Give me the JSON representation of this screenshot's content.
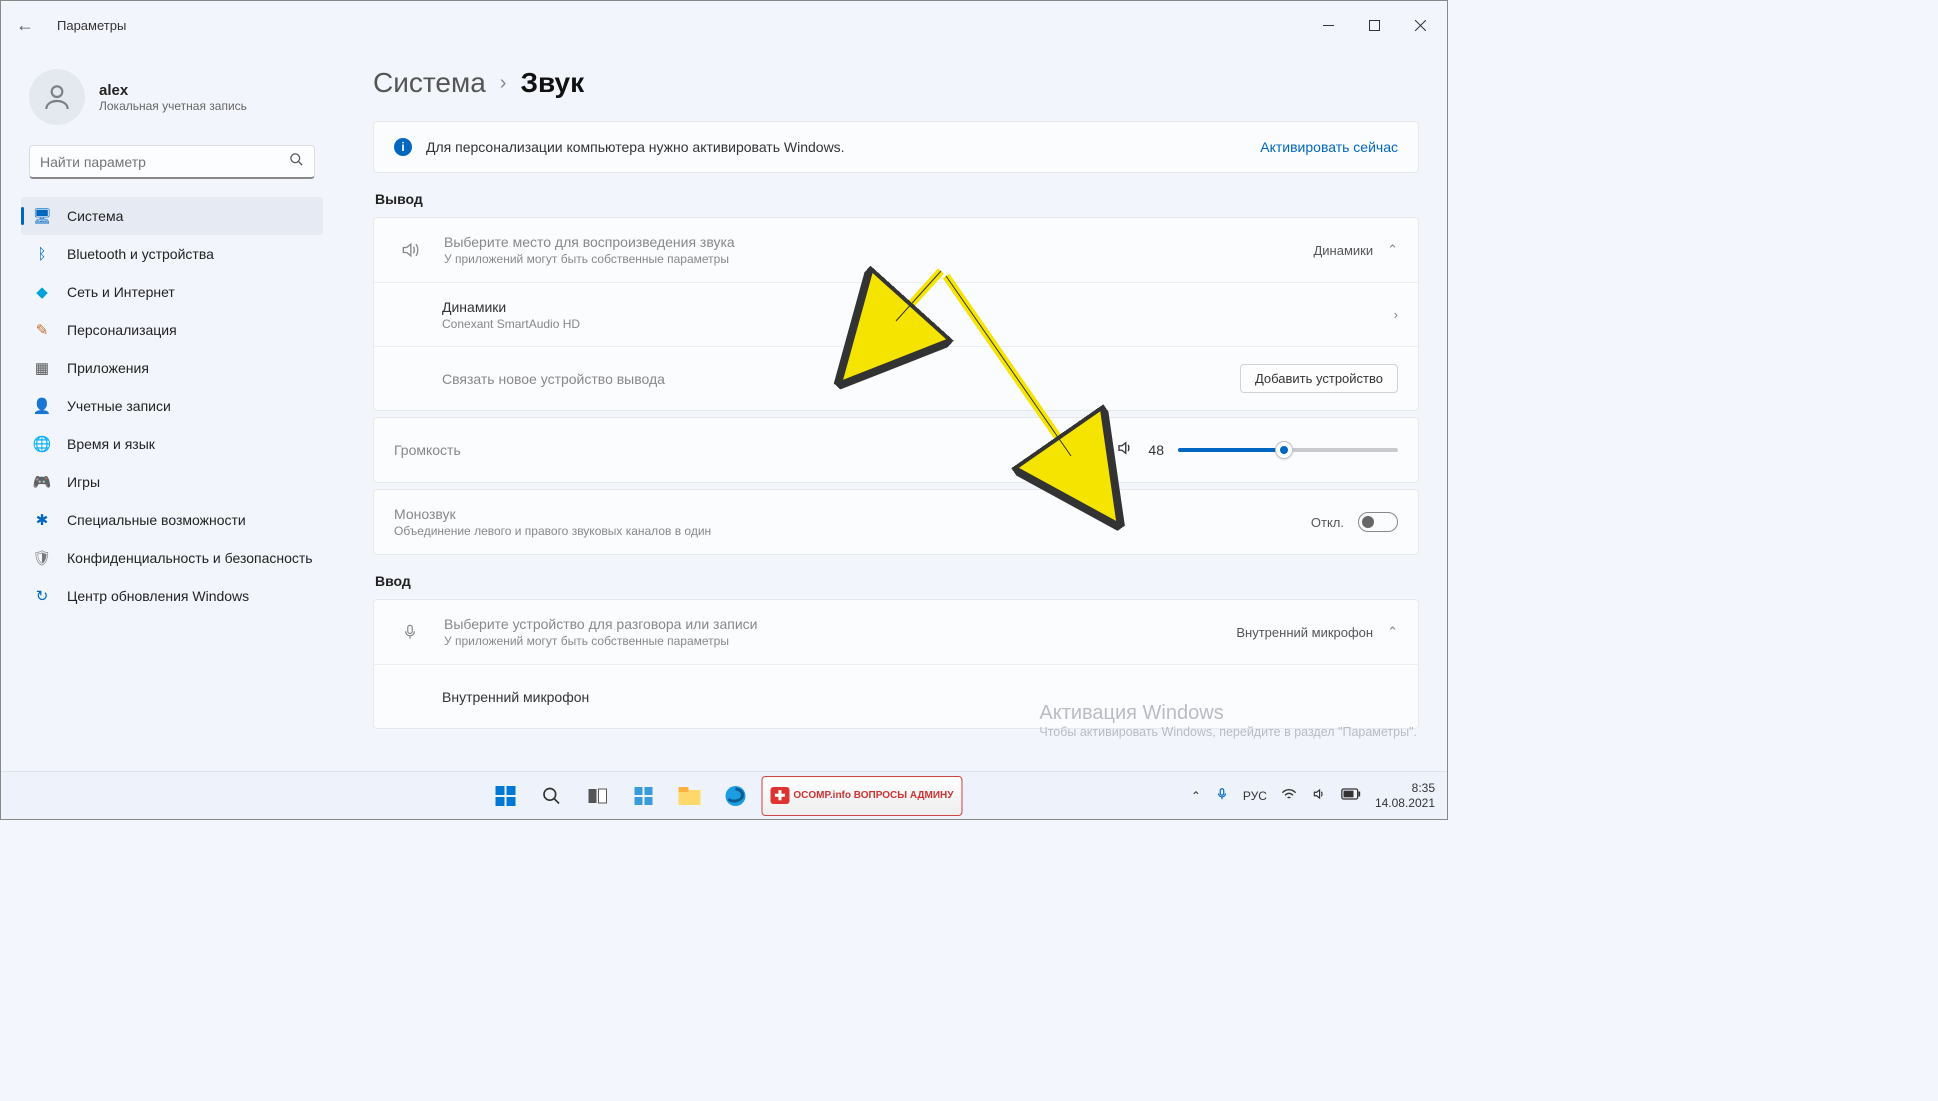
{
  "window": {
    "title": "Параметры",
    "back_icon": "←"
  },
  "user": {
    "name": "alex",
    "subtitle": "Локальная учетная запись"
  },
  "search": {
    "placeholder": "Найти параметр"
  },
  "nav": {
    "items": [
      {
        "label": "Система",
        "icon": "🖥",
        "color": "#0067c0",
        "active": true
      },
      {
        "label": "Bluetooth и устройства",
        "icon": "ᛒ",
        "color": "#0067c0"
      },
      {
        "label": "Сеть и Интернет",
        "icon": "◆",
        "color": "#00a3d8"
      },
      {
        "label": "Персонализация",
        "icon": "✎",
        "color": "#c66a2a"
      },
      {
        "label": "Приложения",
        "icon": "▦",
        "color": "#555"
      },
      {
        "label": "Учетные записи",
        "icon": "👤",
        "color": "#2f8f59"
      },
      {
        "label": "Время и язык",
        "icon": "🌐",
        "color": "#555"
      },
      {
        "label": "Игры",
        "icon": "🎮",
        "color": "#777"
      },
      {
        "label": "Специальные возможности",
        "icon": "✱",
        "color": "#0067c0"
      },
      {
        "label": "Конфиденциальность и безопасность",
        "icon": "🛡",
        "color": "#777"
      },
      {
        "label": "Центр обновления Windows",
        "icon": "↻",
        "color": "#0067c0"
      }
    ]
  },
  "breadcrumb": {
    "parent": "Система",
    "current": "Звук"
  },
  "activation": {
    "message": "Для персонализации компьютера нужно активировать Windows.",
    "link": "Активировать сейчас"
  },
  "output": {
    "section": "Вывод",
    "choose_title": "Выберите место для воспроизведения звука",
    "choose_sub": "У приложений могут быть собственные параметры",
    "current_device": "Динамики",
    "device_name": "Динамики",
    "device_driver": "Conexant SmartAudio HD",
    "pair_text": "Связать новое устройство вывода",
    "pair_button": "Добавить устройство",
    "volume_label": "Громкость",
    "volume_value": "48",
    "volume_percent": 48,
    "mono_title": "Монозвук",
    "mono_sub": "Объединение левого и правого звуковых каналов в один",
    "mono_state": "Откл."
  },
  "input": {
    "section": "Ввод",
    "choose_title": "Выберите устройство для разговора или записи",
    "choose_sub": "У приложений могут быть собственные параметры",
    "current_device": "Внутренний микрофон",
    "device_name": "Внутренний микрофон"
  },
  "watermark": {
    "title": "Активация Windows",
    "sub": "Чтобы активировать Windows, перейдите в раздел \"Параметры\"."
  },
  "taskbar": {
    "lang": "РУС",
    "time": "8:35",
    "date": "14.08.2021"
  },
  "overlay_logo": "OCOMP.info ВОПРОСЫ АДМИНУ"
}
